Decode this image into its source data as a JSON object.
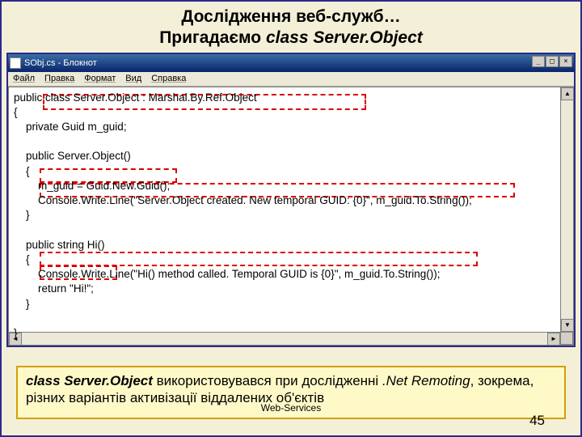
{
  "heading": {
    "line1": "Дослідження веб-служб…",
    "line2a": "Пригадаємо ",
    "line2b": "class Server.Object"
  },
  "window": {
    "title": "SObj.cs - Блокнот",
    "btn_min": "_",
    "btn_max": "□",
    "btn_close": "×"
  },
  "menu": {
    "file": "Файл",
    "edit": "Правка",
    "format": "Формат",
    "view": "Вид",
    "help": "Справка"
  },
  "code": {
    "l1": "public class Server.Object : Marshal.By.Ref.Object",
    "l2": "{",
    "l3": "    private Guid m_guid;",
    "blank1": "",
    "l4": "    public Server.Object()",
    "l5": "    {",
    "l6": "        m_guid = Guid.New.Guid();",
    "l7": "        Console.Write.Line(\"Server.Object created. New temporal GUID: {0}\", m_guid.To.String());",
    "l8": "    }",
    "blank2": "",
    "l9": "    public string Hi()",
    "l10": "    {",
    "l11": "        Console.Write.Line(\"Hi() method called. Temporal GUID is {0}\", m_guid.To.String());",
    "l12": "        return \"Hi!\";",
    "l13": "    }",
    "blank3": "",
    "l14": "}"
  },
  "footnote": {
    "lead": "class Server.Object",
    "mid_a": " використовувався при дослідженні ",
    "mid_b": ".Net Remoting",
    "mid_c": ", зокрема, різних варіантів активізації віддалених об'єктів"
  },
  "footer": {
    "service": "Web-Services",
    "page": "45"
  }
}
